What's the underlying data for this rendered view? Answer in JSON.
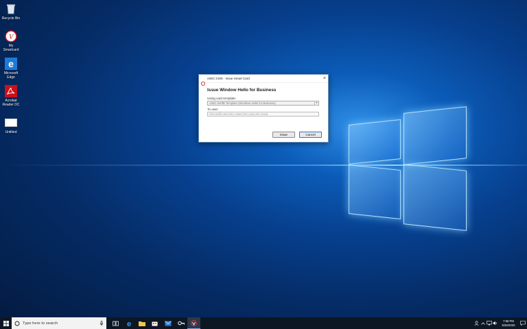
{
  "desktop": {
    "icons": [
      {
        "label": "Recycle Bin",
        "icon": "recycle-bin-icon"
      },
      {
        "label": "My Smartcard",
        "icon": "smartcard-icon"
      },
      {
        "label": "Microsoft Edge",
        "icon": "edge-icon"
      },
      {
        "label": "Acrobat Reader DC",
        "icon": "acrobat-icon"
      },
      {
        "label": "Untitled",
        "icon": "blank-file-icon"
      }
    ]
  },
  "dialog": {
    "title": "vSEC:CMS - Issue Smart Card",
    "heading": "Issue Window Hello for Business",
    "template_label": "Using card template:",
    "template_value": "vSEC:WHfB Template (Windows Hello for Business)",
    "user_label": "To user:",
    "user_value": "CN=Hello User,OU=Users,DC=vsec,DC=local",
    "issue_button": "Issue",
    "cancel_button": "Cancel"
  },
  "taskbar": {
    "search_placeholder": "Type here to search",
    "apps": [
      "task-view-icon",
      "edge-icon",
      "file-explorer-icon",
      "store-icon",
      "mail-icon",
      "key-icon",
      "smartcard-app-icon"
    ],
    "clock_time": "7:58 PM",
    "clock_date": "5/26/2020"
  },
  "colors": {
    "accent": "#0b5cb8",
    "taskbar": "#0d1724",
    "edge_blue": "#1f7ad6",
    "acrobat_red": "#c8121a"
  }
}
